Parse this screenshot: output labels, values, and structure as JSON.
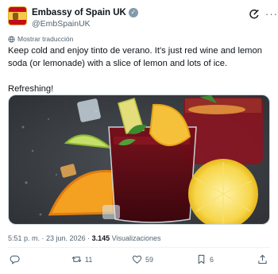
{
  "author": {
    "name": "Embassy of Spain UK",
    "handle": "@EmbSpainUK",
    "verified_mark": "✓"
  },
  "translate_label": "Mostrar traducción",
  "tweet": {
    "text": "Keep cold and enjoy tinto de verano. It's just red wine and lemon soda (or lemonade) with a slice of lemon and lots of ice.\n\nRefreshing!"
  },
  "media": {
    "image_alt": "photo-tinto-de-verano-glasses-with-lemon-orange-ice"
  },
  "meta": {
    "time": "5:51 p. m.",
    "separator": " · ",
    "date": "23 jun. 2026",
    "views_count": "3.145",
    "views_label": "Visualizaciones"
  },
  "actions": {
    "replies": "",
    "retweets": "11",
    "likes": "59",
    "bookmarks": "6"
  },
  "icons": [
    "grok-icon",
    "more-icon",
    "translate-icon",
    "reply-icon",
    "retweet-icon",
    "like-icon",
    "bookmark-icon",
    "share-icon"
  ],
  "colors": {
    "text_primary": "#0f1419",
    "text_secondary": "#536471",
    "verified_badge": "#829aab",
    "flag_red": "#c60b1e",
    "flag_yellow": "#f7c948"
  }
}
